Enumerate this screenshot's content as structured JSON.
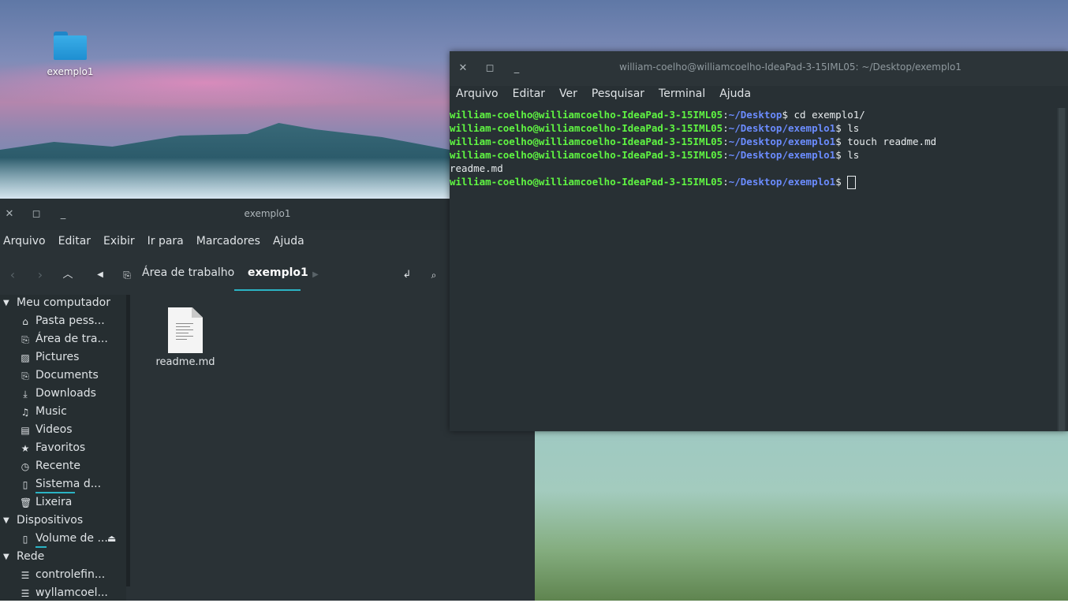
{
  "desktop": {
    "folder_label": "exemplo1"
  },
  "file_manager": {
    "title": "exemplo1",
    "menu": [
      "Arquivo",
      "Editar",
      "Exibir",
      "Ir para",
      "Marcadores",
      "Ajuda"
    ],
    "breadcrumbs": [
      "Área de trabalho",
      "exemplo1"
    ],
    "sidebar": {
      "sections": [
        {
          "label": "Meu computador",
          "items": [
            {
              "label": "Pasta pess...",
              "icon": "home-icon"
            },
            {
              "label": "Área de tra...",
              "icon": "desktop-folder-icon"
            },
            {
              "label": "Pictures",
              "icon": "image-icon"
            },
            {
              "label": "Documents",
              "icon": "document-folder-icon"
            },
            {
              "label": "Downloads",
              "icon": "download-icon"
            },
            {
              "label": "Music",
              "icon": "music-icon"
            },
            {
              "label": "Videos",
              "icon": "video-icon"
            },
            {
              "label": "Favoritos",
              "icon": "star-icon"
            },
            {
              "label": "Recente",
              "icon": "clock-icon"
            },
            {
              "label": "Sistema d...",
              "icon": "drive-icon"
            },
            {
              "label": "Lixeira",
              "icon": "trash-icon"
            }
          ]
        },
        {
          "label": "Dispositivos",
          "items": [
            {
              "label": "Volume de ...",
              "icon": "drive-icon"
            }
          ]
        },
        {
          "label": "Rede",
          "items": [
            {
              "label": "controlefin...",
              "icon": "network-server-icon"
            },
            {
              "label": "wyllamcoel...",
              "icon": "network-server-icon"
            }
          ]
        }
      ]
    },
    "files": [
      {
        "name": "readme.md",
        "icon": "text-file-icon"
      }
    ]
  },
  "terminal": {
    "title": "william-coelho@williamcoelho-IdeaPad-3-15IML05: ~/Desktop/exemplo1",
    "menu": [
      "Arquivo",
      "Editar",
      "Ver",
      "Pesquisar",
      "Terminal",
      "Ajuda"
    ],
    "lines": [
      {
        "user": "william-coelho@williamcoelho-IdeaPad-3-15IML05",
        "sep": ":",
        "path": "~/Desktop",
        "cmd": "$ cd exemplo1/"
      },
      {
        "user": "william-coelho@williamcoelho-IdeaPad-3-15IML05",
        "sep": ":",
        "path": "~/Desktop/exemplo1",
        "cmd": "$ ls"
      },
      {
        "user": "william-coelho@williamcoelho-IdeaPad-3-15IML05",
        "sep": ":",
        "path": "~/Desktop/exemplo1",
        "cmd": "$ touch readme.md"
      },
      {
        "user": "william-coelho@williamcoelho-IdeaPad-3-15IML05",
        "sep": ":",
        "path": "~/Desktop/exemplo1",
        "cmd": "$ ls"
      },
      {
        "output": "readme.md"
      },
      {
        "user": "william-coelho@williamcoelho-IdeaPad-3-15IML05",
        "sep": ":",
        "path": "~/Desktop/exemplo1",
        "cmd": "$ "
      }
    ]
  },
  "colors": {
    "accent": "#2bb3c4",
    "prompt_user": "#5ff542",
    "prompt_path": "#6b8cff"
  }
}
